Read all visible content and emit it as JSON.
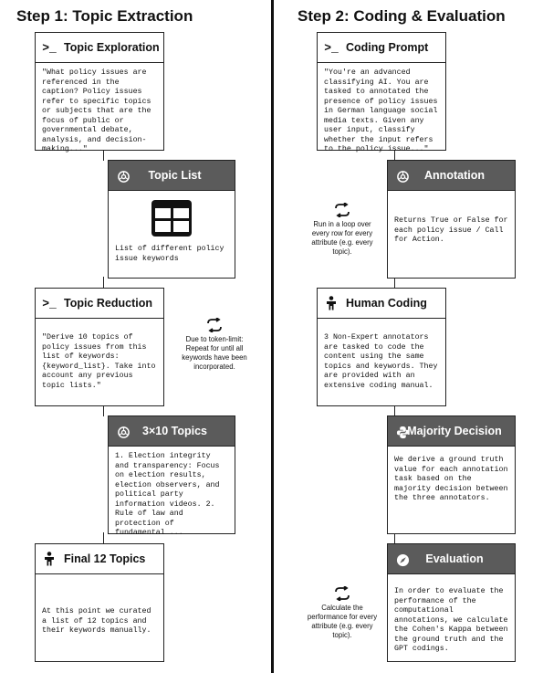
{
  "step1": {
    "title": "Step 1: Topic Extraction",
    "topic_exploration": {
      "title": "Topic Exploration",
      "icon": "terminal-prompt-icon",
      "text": "\"What policy issues are referenced in the caption? Policy issues refer to specific topics or subjects that are the focus of public or governmental debate, analysis, and decision-making...\""
    },
    "topic_list": {
      "title": "Topic List",
      "icon": "openai-icon",
      "table_icon": "table-icon",
      "text": "List of different policy issue keywords"
    },
    "topic_reduction": {
      "title": "Topic Reduction",
      "icon": "terminal-prompt-icon",
      "text": "\"Derive 10 topics of policy issues from this list of keywords: {keyword_list}. Take into account any previous topic lists.\""
    },
    "reduction_note": {
      "icon": "loop-icon",
      "text": "Due to token-limit: Repeat for until all keywords have been incorporated."
    },
    "topics_3x10": {
      "title": "3×10 Topics",
      "icon": "openai-icon",
      "text": "1. Election integrity and transparency: Focus on election results, election observers, and political party information videos. 2. Rule of law and protection of fundamental ..."
    },
    "final_topics": {
      "title": "Final 12 Topics",
      "icon": "human-icon",
      "text": "At this point we curated a list of 12 topics and their keywords manually."
    }
  },
  "step2": {
    "title": "Step 2: Coding & Evaluation",
    "coding_prompt": {
      "title": "Coding Prompt",
      "icon": "terminal-prompt-icon",
      "text": "\"You're an advanced classifying AI. You are tasked to annotated the presence of policy issues in German language social media texts. Given any user input, classify whether the input refers to the policy issue...\""
    },
    "annotation": {
      "title": "Annotation",
      "icon": "openai-icon",
      "text": "Returns True or False for each policy issue / Call for Action."
    },
    "annotation_note": {
      "icon": "loop-icon",
      "text": "Run in a loop over every row for every attribute (e.g. every topic)."
    },
    "human_coding": {
      "title": "Human Coding",
      "icon": "human-icon",
      "text": "3 Non-Expert annotators are tasked to code the content using the same topics and keywords. They are provided with an extensive coding manual."
    },
    "majority_decision": {
      "title": "Majority Decision",
      "icon": "python-icon",
      "text": "We derive a ground truth value for each annotation task based on the majority decision between the three annotators."
    },
    "evaluation": {
      "title": "Evaluation",
      "icon": "compass-icon",
      "text": "In order to evaluate the performance of the computational annotations, we calculate the Cohen's Kappa between the ground truth and the GPT codings."
    },
    "evaluation_note": {
      "icon": "loop-icon",
      "text": "Calculate the performance for every attribute (e.g. every topic)."
    }
  },
  "colors": {
    "dark_header": "#5b5b5b",
    "border": "#222222",
    "background": "#ffffff"
  }
}
